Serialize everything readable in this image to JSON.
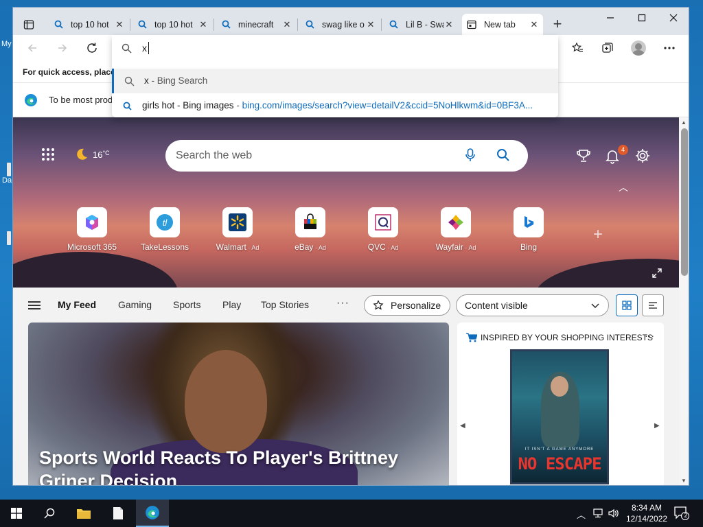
{
  "desktop": {
    "label_my": "My",
    "label_da": "Da"
  },
  "tabs": [
    {
      "title": "top 10 hot",
      "favicon": "search-icon"
    },
    {
      "title": "top 10 hot",
      "favicon": "search-icon"
    },
    {
      "title": "minecraft",
      "favicon": "search-icon"
    },
    {
      "title": "swag like o",
      "favicon": "search-icon"
    },
    {
      "title": "Lil B - Swa",
      "favicon": "search-icon"
    },
    {
      "title": "New tab",
      "favicon": "new-tab-icon",
      "active": true
    }
  ],
  "favorites_bar": {
    "text": "For quick access, place y"
  },
  "infobar": {
    "text": "To be most prod"
  },
  "omnibox": {
    "value": "x",
    "suggestions": [
      {
        "main": "x",
        "suffix": " - Bing Search",
        "url": ""
      },
      {
        "main": "girls hot - Bing images",
        "suffix": " - ",
        "url": "bing.com/images/search?view=detailV2&ccid=5NoHlkwm&id=0BF3A..."
      }
    ]
  },
  "ntp": {
    "weather": {
      "temp": "16",
      "unit": "°C",
      "icon": "moon-icon"
    },
    "search_placeholder": "Search the web",
    "notifications_count": "4",
    "tiles": [
      {
        "label": "Microsoft 365",
        "ad": ""
      },
      {
        "label": "TakeLessons",
        "ad": ""
      },
      {
        "label": "Walmart",
        "ad": " · Ad"
      },
      {
        "label": "eBay",
        "ad": " · Ad"
      },
      {
        "label": "QVC",
        "ad": " · Ad"
      },
      {
        "label": "Wayfair",
        "ad": " · Ad"
      },
      {
        "label": "Bing",
        "ad": ""
      }
    ],
    "feed_tabs": [
      "My Feed",
      "Gaming",
      "Sports",
      "Play",
      "Top Stories"
    ],
    "personalize_label": "Personalize",
    "content_visibility": "Content visible",
    "headline": "Sports World Reacts To Player's Brittney Griner Decision",
    "shopping": {
      "header": "INSPIRED BY YOUR SHOPPING INTERESTS",
      "product_tagline": "IT ISN'T A GAME ANYMORE",
      "product_title": "NO ESCAPE"
    }
  },
  "taskbar": {
    "time": "8:34 AM",
    "date": "12/14/2022",
    "notif_count": "2"
  },
  "colors": {
    "accent": "#0f6cbd",
    "badge": "#e05a2b",
    "taskbar": "#10131a"
  }
}
